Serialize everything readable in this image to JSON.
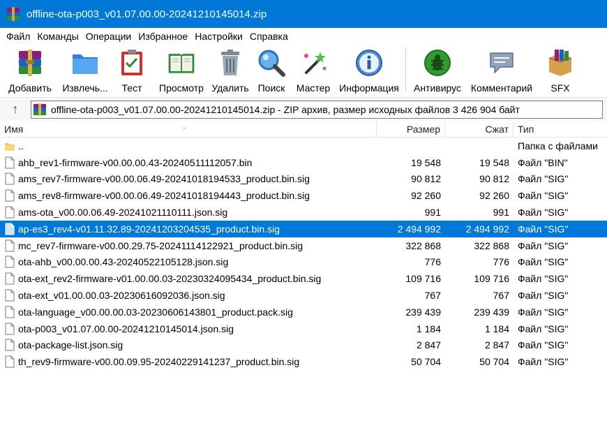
{
  "window": {
    "title": "offline-ota-p003_v01.07.00.00-20241210145014.zip"
  },
  "menu": [
    "Файл",
    "Команды",
    "Операции",
    "Избранное",
    "Настройки",
    "Справка"
  ],
  "toolbar": [
    {
      "label": "Добавить",
      "icon": "add-archive-icon"
    },
    {
      "label": "Извлечь...",
      "icon": "extract-icon"
    },
    {
      "label": "Тест",
      "icon": "test-icon"
    },
    {
      "label": "Просмотр",
      "icon": "view-icon"
    },
    {
      "label": "Удалить",
      "icon": "delete-icon"
    },
    {
      "label": "Поиск",
      "icon": "find-icon"
    },
    {
      "label": "Мастер",
      "icon": "wizard-icon"
    },
    {
      "label": "Информация",
      "icon": "info-icon"
    },
    {
      "label": "Антивирус",
      "icon": "antivirus-icon"
    },
    {
      "label": "Комментарий",
      "icon": "comment-icon"
    },
    {
      "label": "SFX",
      "icon": "sfx-icon"
    }
  ],
  "address": {
    "text": "offline-ota-p003_v01.07.00.00-20241210145014.zip - ZIP архив, размер исходных файлов 3 426 904 байт"
  },
  "columns": {
    "name": "Имя",
    "size": "Размер",
    "packed": "Сжат",
    "type": "Тип"
  },
  "files": [
    {
      "name": "..",
      "size": "",
      "packed": "",
      "type": "Папка с файлами",
      "kind": "folder"
    },
    {
      "name": "ahb_rev1-firmware-v00.00.00.43-20240511112057.bin",
      "size": "19 548",
      "packed": "19 548",
      "type": "Файл \"BIN\"",
      "kind": "file"
    },
    {
      "name": "ams_rev7-firmware-v00.00.06.49-20241018194533_product.bin.sig",
      "size": "90 812",
      "packed": "90 812",
      "type": "Файл \"SIG\"",
      "kind": "file"
    },
    {
      "name": "ams_rev8-firmware-v00.00.06.49-20241018194443_product.bin.sig",
      "size": "92 260",
      "packed": "92 260",
      "type": "Файл \"SIG\"",
      "kind": "file"
    },
    {
      "name": "ams-ota_v00.00.06.49-20241021110111.json.sig",
      "size": "991",
      "packed": "991",
      "type": "Файл \"SIG\"",
      "kind": "file"
    },
    {
      "name": "ap-es3_rev4-v01.11.32.89-20241203204535_product.bin.sig",
      "size": "2 494 992",
      "packed": "2 494 992",
      "type": "Файл \"SIG\"",
      "kind": "file",
      "selected": true
    },
    {
      "name": "mc_rev7-firmware-v00.00.29.75-20241114122921_product.bin.sig",
      "size": "322 868",
      "packed": "322 868",
      "type": "Файл \"SIG\"",
      "kind": "file"
    },
    {
      "name": "ota-ahb_v00.00.00.43-20240522105128.json.sig",
      "size": "776",
      "packed": "776",
      "type": "Файл \"SIG\"",
      "kind": "file"
    },
    {
      "name": "ota-ext_rev2-firmware-v01.00.00.03-20230324095434_product.bin.sig",
      "size": "109 716",
      "packed": "109 716",
      "type": "Файл \"SIG\"",
      "kind": "file"
    },
    {
      "name": "ota-ext_v01.00.00.03-20230616092036.json.sig",
      "size": "767",
      "packed": "767",
      "type": "Файл \"SIG\"",
      "kind": "file"
    },
    {
      "name": "ota-language_v00.00.00.03-20230606143801_product.pack.sig",
      "size": "239 439",
      "packed": "239 439",
      "type": "Файл \"SIG\"",
      "kind": "file"
    },
    {
      "name": "ota-p003_v01.07.00.00-20241210145014.json.sig",
      "size": "1 184",
      "packed": "1 184",
      "type": "Файл \"SIG\"",
      "kind": "file"
    },
    {
      "name": "ota-package-list.json.sig",
      "size": "2 847",
      "packed": "2 847",
      "type": "Файл \"SIG\"",
      "kind": "file"
    },
    {
      "name": "th_rev9-firmware-v00.00.09.95-20240229141237_product.bin.sig",
      "size": "50 704",
      "packed": "50 704",
      "type": "Файл \"SIG\"",
      "kind": "file"
    }
  ],
  "colors": {
    "titlebar": "#0078d7",
    "selection": "#0078d7"
  }
}
